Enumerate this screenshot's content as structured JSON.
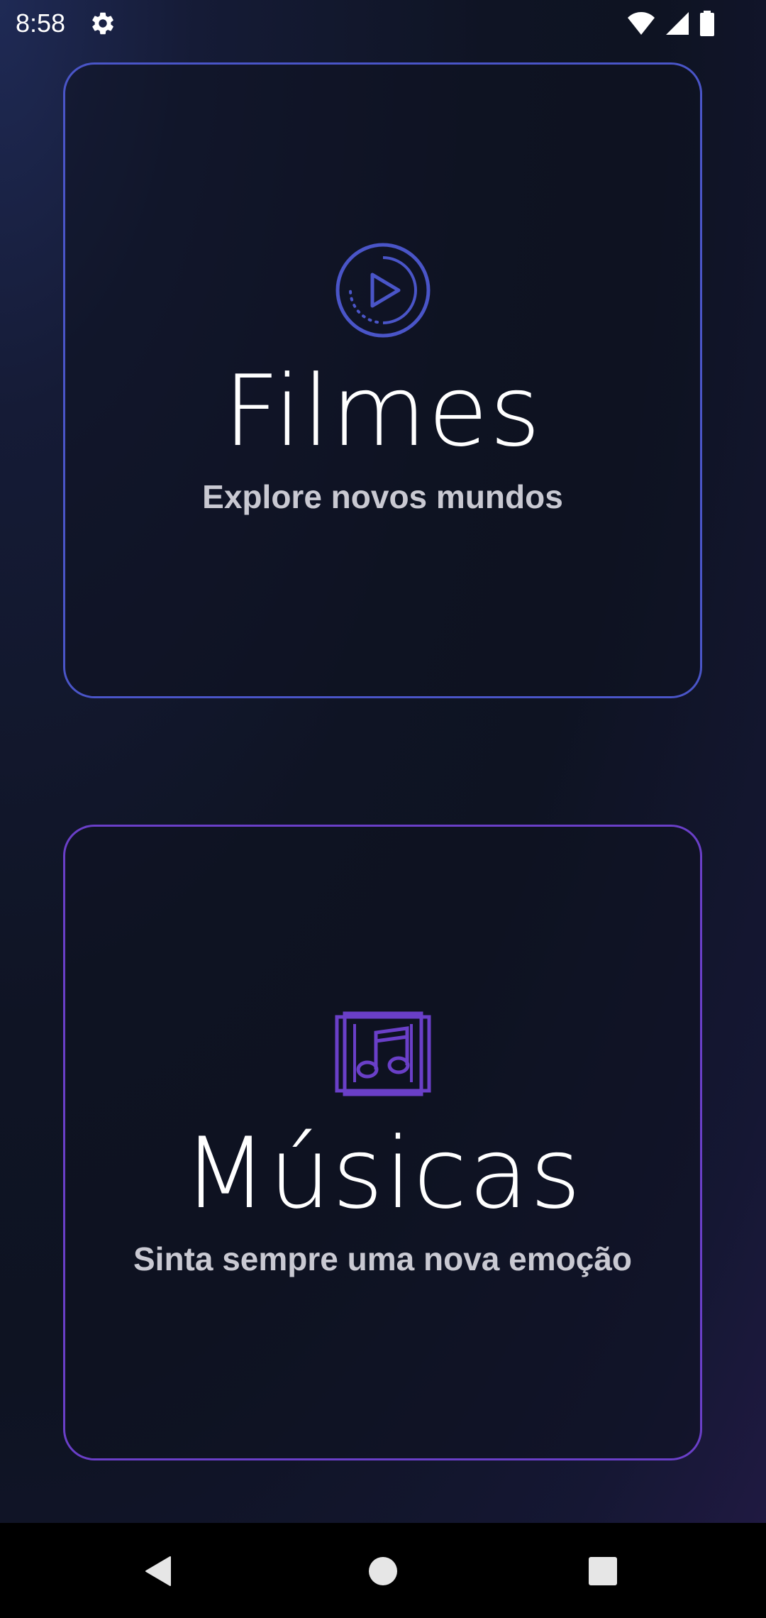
{
  "status_bar": {
    "time": "8:58",
    "icons": [
      "gear-icon",
      "wifi-icon",
      "signal-icon",
      "battery-icon"
    ]
  },
  "cards": [
    {
      "icon": "play-circle-icon",
      "title": "Filmes",
      "subtitle": "Explore novos mundos",
      "border_color": "#4a55c8"
    },
    {
      "icon": "music-album-icon",
      "title": "Músicas",
      "subtitle": "Sinta sempre uma nova emoção",
      "border_color": "#6a3fc8"
    }
  ],
  "nav_bar": {
    "buttons": [
      "back-icon",
      "home-icon",
      "recents-icon"
    ]
  },
  "colors": {
    "accent_blue": "#4a55c8",
    "accent_purple": "#6a3fc8",
    "subtitle_gray": "#c9c9d2",
    "background": "#0f1424"
  }
}
